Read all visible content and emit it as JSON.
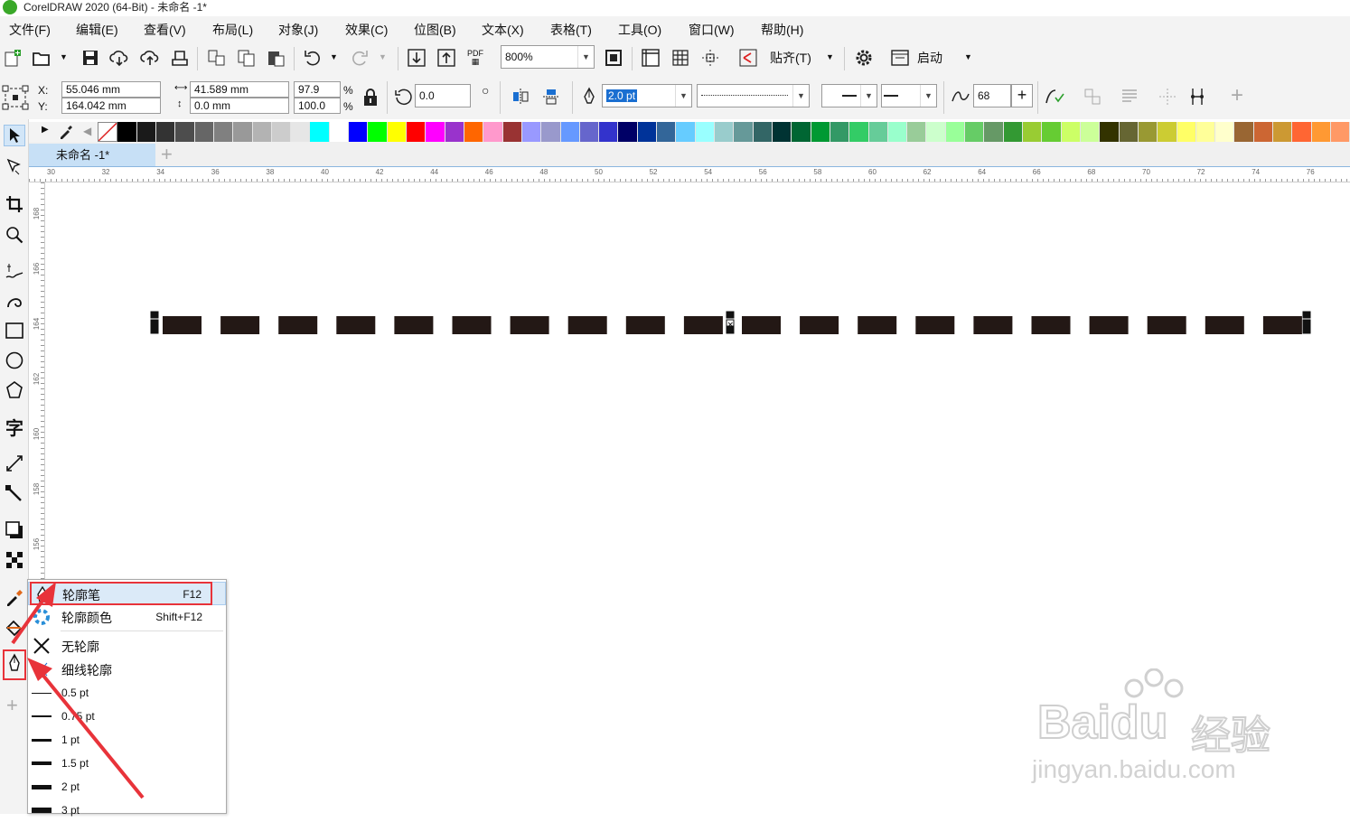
{
  "window": {
    "title": "CorelDRAW 2020 (64-Bit) - 未命名 -1*"
  },
  "menu": [
    {
      "label": "文件(F)"
    },
    {
      "label": "编辑(E)"
    },
    {
      "label": "查看(V)"
    },
    {
      "label": "布局(L)"
    },
    {
      "label": "对象(J)"
    },
    {
      "label": "效果(C)"
    },
    {
      "label": "位图(B)"
    },
    {
      "label": "文本(X)"
    },
    {
      "label": "表格(T)"
    },
    {
      "label": "工具(O)"
    },
    {
      "label": "窗口(W)"
    },
    {
      "label": "帮助(H)"
    }
  ],
  "toolbar": {
    "zoom_value": "800%",
    "snap_label": "贴齐(T)",
    "launch_label": "启动",
    "pdf_label": "PDF"
  },
  "properties": {
    "x_label": "X:",
    "y_label": "Y:",
    "x_value": "55.046 mm",
    "y_value": "164.042 mm",
    "width_value": "41.589 mm",
    "height_value": "0.0 mm",
    "scale_w": "97.9",
    "scale_h": "100.0",
    "percent": "%",
    "rotation": "0.0",
    "outline_width": "2.0 pt",
    "smoothing": "68"
  },
  "palette": [
    "#ffffff",
    "#000000",
    "#1a1a1a",
    "#333333",
    "#4d4d4d",
    "#666666",
    "#808080",
    "#999999",
    "#b3b3b3",
    "#cccccc",
    "#e6e6e6",
    "#00ffff",
    "#ffffff",
    "#0000ff",
    "#00ff00",
    "#ffff00",
    "#ff0000",
    "#ff00ff",
    "#9933cc",
    "#ff6600",
    "#ff99cc",
    "#993333",
    "#9999ff",
    "#9999cc",
    "#6699ff",
    "#6666cc",
    "#3333cc",
    "#000066",
    "#003399",
    "#336699",
    "#66ccff",
    "#99ffff",
    "#99cccc",
    "#669999",
    "#336666",
    "#003333",
    "#006633",
    "#009933",
    "#339966",
    "#33cc66",
    "#66cc99",
    "#99ffcc",
    "#99cc99",
    "#ccffcc",
    "#99ff99",
    "#66cc66",
    "#669966",
    "#339933",
    "#99cc33",
    "#66cc33",
    "#ccff66",
    "#ccff99",
    "#333300",
    "#666633",
    "#999933",
    "#cccc33",
    "#ffff66",
    "#ffff99",
    "#ffffcc",
    "#996633",
    "#cc6633",
    "#cc9933",
    "#ff6633",
    "#ff9933",
    "#ff9966"
  ],
  "document": {
    "tab_label": "未命名 -1*",
    "ruler_h": [
      "30",
      "32",
      "34",
      "36",
      "38",
      "40",
      "42",
      "44",
      "46",
      "48",
      "50",
      "52",
      "54",
      "56",
      "58",
      "60",
      "62",
      "64",
      "66",
      "68",
      "70",
      "72",
      "74",
      "76"
    ],
    "ruler_v": [
      "168",
      "166",
      "164",
      "162",
      "160",
      "158",
      "156"
    ]
  },
  "flyout": {
    "items": [
      {
        "label": "轮廓笔",
        "shortcut": "F12"
      },
      {
        "label": "轮廓颜色",
        "shortcut": "Shift+F12"
      },
      {
        "label": "无轮廓",
        "shortcut": ""
      },
      {
        "label": "细线轮廓",
        "shortcut": ""
      },
      {
        "label": "0.5 pt",
        "shortcut": ""
      },
      {
        "label": "0.75 pt",
        "shortcut": ""
      },
      {
        "label": "1 pt",
        "shortcut": ""
      },
      {
        "label": "1.5 pt",
        "shortcut": ""
      },
      {
        "label": "2 pt",
        "shortcut": ""
      },
      {
        "label": "3 pt",
        "shortcut": ""
      }
    ]
  },
  "watermark": {
    "brand": "Bai",
    "brand2": "du",
    "cn": "经验",
    "url": "jingyan.baidu.com"
  }
}
